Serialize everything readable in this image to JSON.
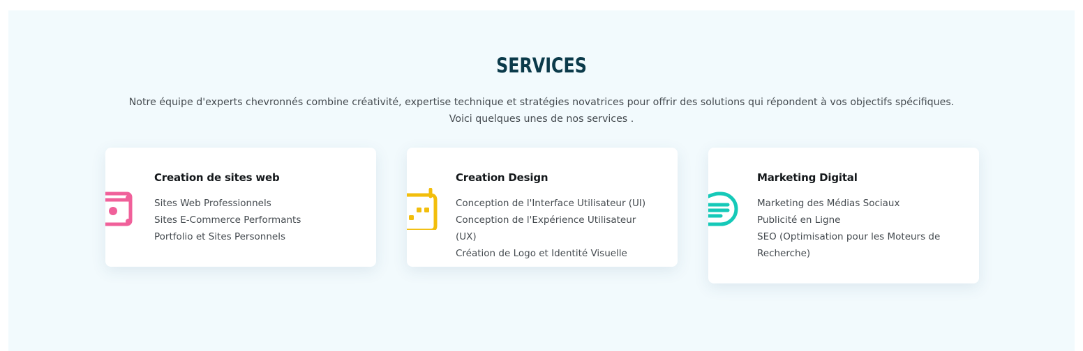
{
  "section": {
    "title": "SERVICES",
    "intro_line1": "Notre équipe d'experts chevronnés combine créativité, expertise technique et stratégies novatrices pour offrir des solutions qui répondent à vos objectifs spécifiques.",
    "intro_line2": "Voici quelques unes de nos services ."
  },
  "cards": [
    {
      "title": "Creation de sites web",
      "icon": "money-bill-icon",
      "color": "#f0609a",
      "items": [
        "Sites Web Professionnels",
        "Sites E-Commerce Performants",
        "Portfolio et Sites Personnels"
      ]
    },
    {
      "title": "Creation Design",
      "icon": "calendar-icon",
      "color": "#f2be0c",
      "items": [
        "Conception de l'Interface Utilisateur (UI)",
        "Conception de l'Expérience Utilisateur (UX)",
        "Création de Logo et Identité Visuelle"
      ]
    },
    {
      "title": "Marketing Digital",
      "icon": "chat-lines-icon",
      "color": "#15c9b8",
      "items": [
        "Marketing des Médias Sociaux",
        "Publicité en Ligne",
        "SEO (Optimisation pour les Moteurs de Recherche)"
      ]
    }
  ]
}
